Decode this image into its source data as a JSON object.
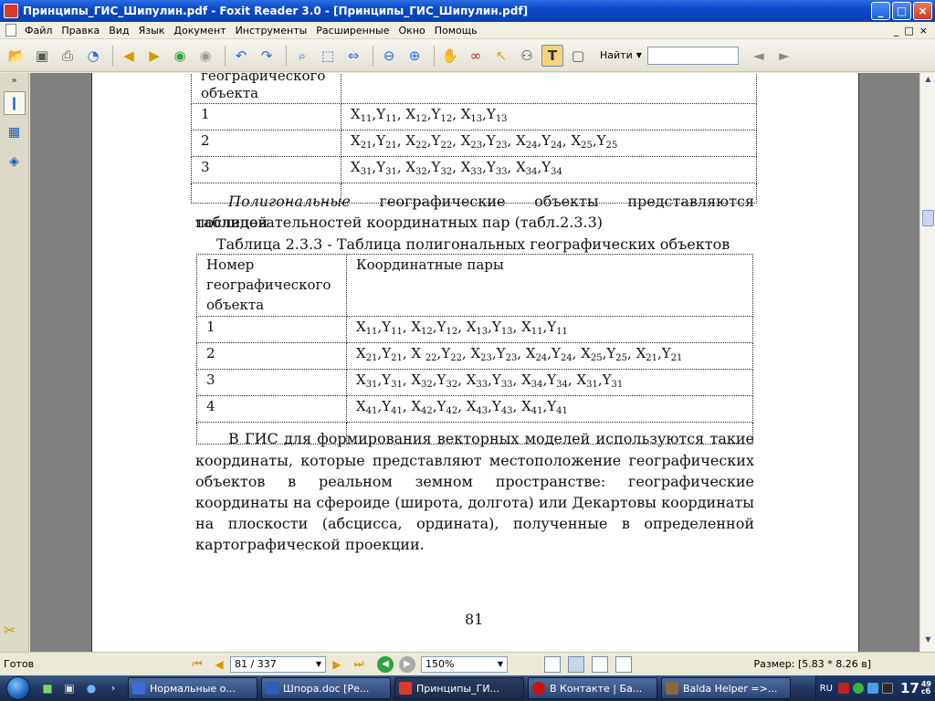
{
  "window": {
    "title": "Принципы_ГИС_Шипулин.pdf - Foxit Reader 3.0 - [Принципы_ГИС_Шипулин.pdf]",
    "minimize": "_",
    "maximize": "□",
    "close": "×"
  },
  "menu": {
    "items": [
      "Файл",
      "Правка",
      "Вид",
      "Язык",
      "Документ",
      "Инструменты",
      "Расширенные",
      "Окно",
      "Помощь"
    ],
    "mdi": [
      "_",
      "□",
      "×"
    ]
  },
  "toolbar": {
    "find_label": "Найти",
    "find_value": "",
    "icons": [
      "open-icon",
      "save-icon",
      "print-icon",
      "web-icon",
      "prev-icon",
      "next-icon",
      "back-icon",
      "forward-icon",
      "rotate-left-icon",
      "rotate-right-icon",
      "zoom-icon",
      "fit-page-icon",
      "fit-width-icon",
      "zoom-out-icon",
      "zoom-in-icon",
      "hand-icon",
      "glasses-icon",
      "select-icon",
      "binoculars-icon",
      "text-select-icon",
      "snapshot-icon"
    ]
  },
  "document": {
    "table1": {
      "header_fragment_top": "географического",
      "header_fragment": "объекта",
      "rows": [
        {
          "num": "1",
          "coords": "X<sub>11</sub>,Y<sub>11</sub>, X<sub>12</sub>,Y<sub>12</sub>, X<sub>13</sub>,Y<sub>13</sub>"
        },
        {
          "num": "2",
          "coords": "X<sub>21</sub>,Y<sub>21</sub>, X<sub>22</sub>,Y<sub>22</sub>, X<sub>23</sub>,Y<sub>23</sub>, X<sub>24</sub>,Y<sub>24</sub>, X<sub>25</sub>,Y<sub>25</sub>"
        },
        {
          "num": "3",
          "coords": "X<sub>31</sub>,Y<sub>31</sub>, X<sub>32</sub>,Y<sub>32</sub>, X<sub>33</sub>,Y<sub>33</sub>, X<sub>34</sub>,Y<sub>34</sub>"
        }
      ]
    },
    "para1_italic": "Полигональные",
    "para1_rest": " географические объекты представляются таблицей",
    "para1_line2": "последовательностей  координатных пар (табл.2.3.3)",
    "table2_caption": "Таблица 2.3.3 - Таблица полигональных географических объектов",
    "table2": {
      "header_num": "Номер географического объекта",
      "header_coords": "Координатные пары",
      "rows": [
        {
          "num": "1",
          "coords": "X<sub>11</sub>,Y<sub>11</sub>, X<sub>12</sub>,Y<sub>12</sub>, X<sub>13</sub>,Y<sub>13</sub>, X<sub>11</sub>,Y<sub>11</sub>"
        },
        {
          "num": "2",
          "coords": "X<sub>21</sub>,Y<sub>21</sub>, X <sub>22</sub>,Y<sub>22</sub>, X<sub>23</sub>,Y<sub>23</sub>, X<sub>24</sub>,Y<sub>24</sub>, X<sub>25</sub>,Y<sub>25</sub>, X<sub>21</sub>,Y<sub>21</sub>"
        },
        {
          "num": "3",
          "coords": "X<sub>31</sub>,Y<sub>31</sub>, X<sub>32</sub>,Y<sub>32</sub>, X<sub>33</sub>,Y<sub>33</sub>, X<sub>34</sub>,Y<sub>34</sub>, X<sub>31</sub>,Y<sub>31</sub>"
        },
        {
          "num": "4",
          "coords": "X<sub>41</sub>,Y<sub>41</sub>, X<sub>42</sub>,Y<sub>42</sub>, X<sub>43</sub>,Y<sub>43</sub>, X<sub>41</sub>,Y<sub>41</sub>"
        }
      ]
    },
    "para2_lines": [
      "В ГИС для формирования векторных моделей используются такие",
      "координаты, которые представляют местоположение географических",
      "объектов в реальном земном пространстве: географические",
      "координаты на сфероиде (широта, долгота) или Декартовы координаты",
      "на плоскости (абсцисса, ордината), полученные в определенной",
      "картографической проекции."
    ],
    "page_number": "81"
  },
  "status": {
    "ready": "Готов",
    "page_value": "81 / 337",
    "zoom_value": "150%",
    "size_label": "Размер: [5.83 * 8.26 в]"
  },
  "taskbar": {
    "tasks": [
      {
        "label": "Нормальные о...",
        "active": false,
        "color": "#3a6fd8"
      },
      {
        "label": "Шпора.doc [Ре...",
        "active": false,
        "color": "#2f5db7"
      },
      {
        "label": "Принципы_ГИ...",
        "active": true,
        "color": "#d83a2b"
      },
      {
        "label": "В Контакте | Ба...",
        "active": false,
        "color": "#cc1111"
      },
      {
        "label": "Balda Helper =>...",
        "active": false,
        "color": "#8a6a3a"
      }
    ],
    "lang": "RU",
    "time": "17",
    "time_min": "49",
    "time_day": "сб"
  }
}
